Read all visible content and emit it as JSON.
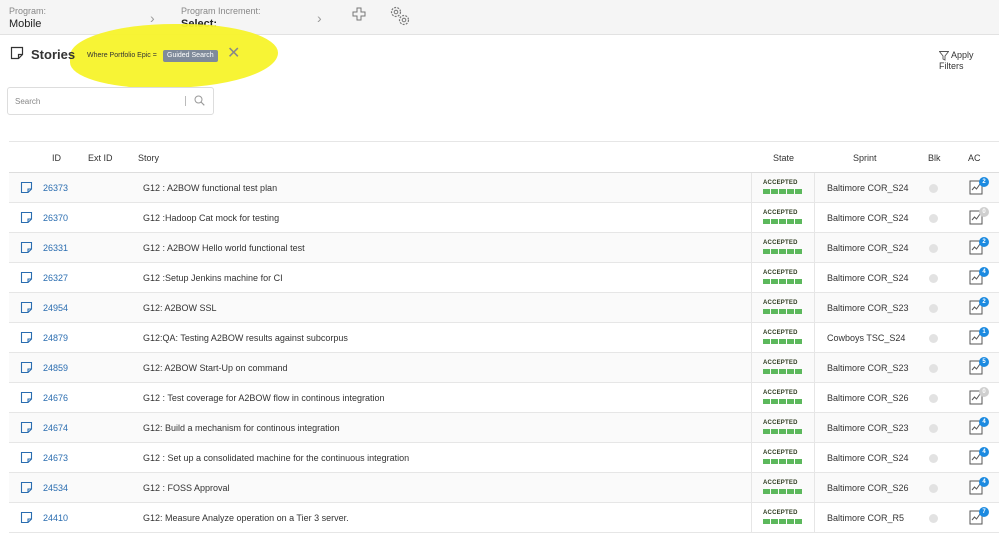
{
  "topbar": {
    "program_label": "Program:",
    "program_value": "Mobile",
    "pi_label": "Program Increment:",
    "pi_value": "Select:"
  },
  "header": {
    "title": "Stories",
    "filter_text": "Where Portfolio Epic =",
    "filter_chip": "Guided Search",
    "apply_filters": "Apply Filters"
  },
  "search": {
    "placeholder": "Search"
  },
  "columns": {
    "id": "ID",
    "ext_id": "Ext ID",
    "story": "Story",
    "state": "State",
    "sprint": "Sprint",
    "blk": "Blk",
    "ac": "AC"
  },
  "rows": [
    {
      "id": "26373",
      "story": "G12 : A2BOW functional test plan",
      "state": "ACCEPTED",
      "sprint": "Baltimore COR_S24",
      "ac": "2"
    },
    {
      "id": "26370",
      "story": "G12 :Hadoop Cat mock for testing",
      "state": "ACCEPTED",
      "sprint": "Baltimore COR_S24",
      "ac": "0"
    },
    {
      "id": "26331",
      "story": "G12 : A2BOW Hello world functional test",
      "state": "ACCEPTED",
      "sprint": "Baltimore COR_S24",
      "ac": "2"
    },
    {
      "id": "26327",
      "story": "G12 :Setup Jenkins machine for CI",
      "state": "ACCEPTED",
      "sprint": "Baltimore COR_S24",
      "ac": "4"
    },
    {
      "id": "24954",
      "story": "G12: A2BOW SSL",
      "state": "ACCEPTED",
      "sprint": "Baltimore COR_S23",
      "ac": "2"
    },
    {
      "id": "24879",
      "story": "G12:QA: Testing A2BOW results against subcorpus",
      "state": "ACCEPTED",
      "sprint": "Cowboys TSC_S24",
      "ac": "1"
    },
    {
      "id": "24859",
      "story": "G12: A2BOW Start-Up on command",
      "state": "ACCEPTED",
      "sprint": "Baltimore COR_S23",
      "ac": "5"
    },
    {
      "id": "24676",
      "story": "G12 : Test coverage for A2BOW flow in continous integration",
      "state": "ACCEPTED",
      "sprint": "Baltimore COR_S26",
      "ac": "0"
    },
    {
      "id": "24674",
      "story": "G12: Build a mechanism for continous integration",
      "state": "ACCEPTED",
      "sprint": "Baltimore COR_S23",
      "ac": "4"
    },
    {
      "id": "24673",
      "story": "G12 : Set up a consolidated machine for the continuous integration",
      "state": "ACCEPTED",
      "sprint": "Baltimore COR_S24",
      "ac": "4"
    },
    {
      "id": "24534",
      "story": "G12 : FOSS Approval",
      "state": "ACCEPTED",
      "sprint": "Baltimore COR_S26",
      "ac": "4"
    },
    {
      "id": "24410",
      "story": "G12: Measure Analyze operation on a Tier 3 server.",
      "state": "ACCEPTED",
      "sprint": "Baltimore COR_R5",
      "ac": "7"
    }
  ],
  "colors": {
    "link": "#2a6db0",
    "accepted_bar": "#5cb85c",
    "badge": "#1c8ae0",
    "highlight": "#f7f32a"
  }
}
